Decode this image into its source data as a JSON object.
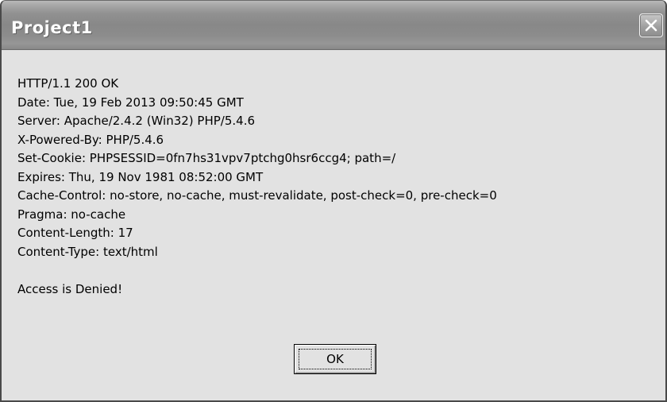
{
  "window": {
    "title": "Project1",
    "close_icon": "close-icon"
  },
  "message": {
    "headers": [
      "HTTP/1.1 200 OK",
      "Date: Tue, 19 Feb 2013 09:50:45 GMT",
      "Server: Apache/2.4.2 (Win32) PHP/5.4.6",
      "X-Powered-By: PHP/5.4.6",
      "Set-Cookie: PHPSESSID=0fn7hs31vpv7ptchg0hsr6ccg4; path=/",
      "Expires: Thu, 19 Nov 1981 08:52:00 GMT",
      "Cache-Control: no-store, no-cache, must-revalidate, post-check=0, pre-check=0",
      "Pragma: no-cache",
      "Content-Length: 17",
      "Content-Type: text/html"
    ],
    "body": "Access is Denied!"
  },
  "buttons": {
    "ok_label": "OK"
  }
}
